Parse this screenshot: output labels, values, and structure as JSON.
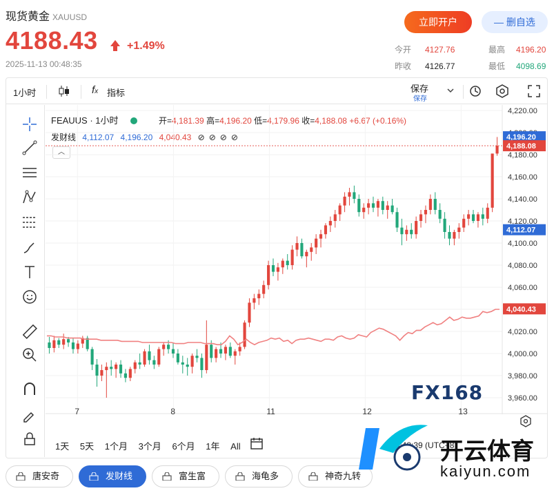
{
  "header": {
    "title": "现货黄金",
    "code": "XAUUSD",
    "price": "4188.43",
    "change_pct": "+1.49%",
    "timestamp": "2025-11-13 00:48:35",
    "btn_open": "立即开户",
    "btn_fav": "— 删自选",
    "stats": {
      "open_label": "今开",
      "open": "4127.76",
      "high_label": "最高",
      "high": "4196.20",
      "prev_label": "昨收",
      "prev": "4126.77",
      "low_label": "最低",
      "low": "4098.69"
    }
  },
  "toolbar": {
    "interval": "1小时",
    "indicator": "指标",
    "save": "保存",
    "save_sub": "保存"
  },
  "legend": {
    "ticker": "FEAUUS · 1小时",
    "open_label": "开=",
    "open": "4,181.39",
    "high_label": "高=",
    "high": "4,196.20",
    "low_label": "低=",
    "low": "4,179.96",
    "close_label": "收=",
    "close": "4,188.08",
    "change": "+6.67 (+0.16%)",
    "indicator_name": "发财线",
    "ind_v1": "4,112.07",
    "ind_v2": "4,196.20",
    "ind_v3": "4,040.43"
  },
  "ranges": [
    "1天",
    "5天",
    "1个月",
    "3个月",
    "6个月",
    "1年",
    "All"
  ],
  "time_readout": "00:48:39 (UTC+8)",
  "pills": [
    "唐安奇",
    "发财线",
    "富生富",
    "海龟多",
    "神奇九转"
  ],
  "watermark": "FX168",
  "logo_text": "开云体育",
  "logo_url": "kaiyun.com",
  "colors": {
    "up": "#e2463d",
    "down": "#22a77a",
    "accent": "#2f6bd6",
    "ma": "#f08080"
  },
  "chart_data": {
    "type": "candlestick",
    "y_ticks": [
      "4,220.00",
      "4,200.00",
      "4,180.00",
      "4,160.00",
      "4,140.00",
      "4,120.00",
      "4,100.00",
      "4,080.00",
      "4,060.00",
      "4,040.00",
      "4,020.00",
      "4,000.00",
      "3,980.00",
      "3,960.00"
    ],
    "y_range": [
      3950,
      4225
    ],
    "x_ticks": [
      "7",
      "8",
      "11",
      "12",
      "13"
    ],
    "price_tags": [
      {
        "text": "4,196.20",
        "value": 4196.2,
        "color": "#2f6bd6"
      },
      {
        "text": "4,188.08",
        "value": 4188.08,
        "color": "#e2463d"
      },
      {
        "text": "4,112.07",
        "value": 4112.07,
        "color": "#2f6bd6"
      },
      {
        "text": "4,040.43",
        "value": 4040.43,
        "color": "#e2463d"
      }
    ],
    "candles": [
      [
        4010,
        4015,
        4000,
        4005
      ],
      [
        4005,
        4016,
        4001,
        4012
      ],
      [
        4012,
        4014,
        4005,
        4008
      ],
      [
        4008,
        4018,
        4004,
        4013
      ],
      [
        4013,
        4015,
        4006,
        4010
      ],
      [
        4010,
        4014,
        4000,
        4004
      ],
      [
        4004,
        4012,
        4000,
        4009
      ],
      [
        4009,
        4016,
        4005,
        4014
      ],
      [
        4014,
        4016,
        4002,
        4004
      ],
      [
        4004,
        4006,
        3985,
        3990
      ],
      [
        3990,
        3995,
        3970,
        3980
      ],
      [
        3980,
        3990,
        3975,
        3985
      ],
      [
        3985,
        3992,
        3960,
        3988
      ],
      [
        3988,
        3994,
        3980,
        3986
      ],
      [
        3986,
        3992,
        3978,
        3990
      ],
      [
        3990,
        3994,
        3978,
        3982
      ],
      [
        3982,
        3986,
        3974,
        3978
      ],
      [
        3978,
        3988,
        3975,
        3986
      ],
      [
        3986,
        3994,
        3982,
        3992
      ],
      [
        3992,
        4000,
        3986,
        3990
      ],
      [
        3990,
        4004,
        3988,
        4002
      ],
      [
        4002,
        4008,
        3990,
        3994
      ],
      [
        3994,
        3998,
        3986,
        3990
      ],
      [
        3990,
        4006,
        3988,
        4004
      ],
      [
        4004,
        4010,
        3998,
        4008
      ],
      [
        4008,
        4012,
        4000,
        4004
      ],
      [
        4004,
        4010,
        3996,
        4000
      ],
      [
        4000,
        4004,
        3990,
        3992
      ],
      [
        3992,
        3998,
        3982,
        3990
      ],
      [
        3990,
        3996,
        3980,
        3988
      ],
      [
        3988,
        4000,
        3982,
        3998
      ],
      [
        3998,
        4004,
        3992,
        3996
      ],
      [
        3996,
        4000,
        3978,
        3985
      ],
      [
        3985,
        4030,
        3982,
        4008
      ],
      [
        4008,
        4012,
        3992,
        3996
      ],
      [
        3996,
        4006,
        3992,
        4004
      ],
      [
        4004,
        4010,
        3996,
        4000
      ],
      [
        4000,
        4008,
        3994,
        4006
      ],
      [
        4006,
        4010,
        3996,
        3998
      ],
      [
        3998,
        4004,
        3990,
        4002
      ],
      [
        4002,
        4010,
        3998,
        4006
      ],
      [
        4006,
        4030,
        4004,
        4028
      ],
      [
        4028,
        4050,
        4024,
        4046
      ],
      [
        4046,
        4054,
        4040,
        4050
      ],
      [
        4050,
        4058,
        4044,
        4054
      ],
      [
        4054,
        4066,
        4050,
        4062
      ],
      [
        4062,
        4084,
        4058,
        4080
      ],
      [
        4080,
        4086,
        4070,
        4074
      ],
      [
        4074,
        4082,
        4066,
        4078
      ],
      [
        4078,
        4086,
        4072,
        4084
      ],
      [
        4084,
        4090,
        4076,
        4080
      ],
      [
        4080,
        4098,
        4076,
        4094
      ],
      [
        4094,
        4106,
        4088,
        4100
      ],
      [
        4100,
        4104,
        4086,
        4088
      ],
      [
        4088,
        4094,
        4078,
        4092
      ],
      [
        4092,
        4100,
        4084,
        4096
      ],
      [
        4096,
        4108,
        4090,
        4104
      ],
      [
        4104,
        4112,
        4096,
        4108
      ],
      [
        4108,
        4118,
        4104,
        4116
      ],
      [
        4116,
        4124,
        4110,
        4120
      ],
      [
        4120,
        4130,
        4114,
        4126
      ],
      [
        4126,
        4136,
        4120,
        4134
      ],
      [
        4134,
        4146,
        4128,
        4142
      ],
      [
        4142,
        4150,
        4134,
        4146
      ],
      [
        4146,
        4152,
        4136,
        4140
      ],
      [
        4140,
        4144,
        4124,
        4128
      ],
      [
        4128,
        4136,
        4122,
        4132
      ],
      [
        4132,
        4140,
        4126,
        4136
      ],
      [
        4136,
        4142,
        4128,
        4132
      ],
      [
        4132,
        4140,
        4124,
        4138
      ],
      [
        4138,
        4142,
        4126,
        4130
      ],
      [
        4130,
        4138,
        4122,
        4134
      ],
      [
        4134,
        4140,
        4126,
        4128
      ],
      [
        4128,
        4132,
        4110,
        4114
      ],
      [
        4114,
        4122,
        4098,
        4108
      ],
      [
        4108,
        4116,
        4102,
        4112
      ],
      [
        4112,
        4118,
        4104,
        4108
      ],
      [
        4108,
        4124,
        4104,
        4120
      ],
      [
        4120,
        4130,
        4114,
        4126
      ],
      [
        4126,
        4134,
        4118,
        4130
      ],
      [
        4130,
        4144,
        4126,
        4140
      ],
      [
        4140,
        4146,
        4126,
        4130
      ],
      [
        4130,
        4136,
        4118,
        4122
      ],
      [
        4122,
        4128,
        4104,
        4110
      ],
      [
        4110,
        4116,
        4098,
        4104
      ],
      [
        4104,
        4112,
        4098,
        4110
      ],
      [
        4110,
        4118,
        4104,
        4114
      ],
      [
        4114,
        4126,
        4110,
        4122
      ],
      [
        4122,
        4130,
        4116,
        4126
      ],
      [
        4126,
        4130,
        4118,
        4120
      ],
      [
        4120,
        4128,
        4114,
        4126
      ],
      [
        4126,
        4132,
        4116,
        4122
      ],
      [
        4122,
        4136,
        4118,
        4132
      ],
      [
        4132,
        4164,
        4128,
        4181
      ],
      [
        4181,
        4196,
        4179,
        4188
      ]
    ],
    "ma_line": [
      4016,
      4016,
      4015,
      4015,
      4015,
      4014,
      4014,
      4014,
      4014,
      4013,
      4013,
      4013,
      4013,
      4012,
      4012,
      4012,
      4012,
      4012,
      4011,
      4011,
      4011,
      4011,
      4011,
      4010,
      4010,
      4010,
      4010,
      4010,
      4010,
      4010,
      4010,
      4009,
      4009,
      4009,
      4010,
      4010,
      4010,
      4010,
      4009,
      4009,
      4009,
      4008,
      4008,
      4011,
      4016,
      4013,
      4008,
      4010,
      4013,
      4010,
      4008,
      4010,
      4011,
      4012,
      4014,
      4013,
      4014,
      4011,
      4012,
      4009,
      4012,
      4013,
      4013,
      4014,
      4013,
      4012,
      4011,
      4013,
      4013,
      4012,
      4015,
      4016,
      4014,
      4013,
      4014,
      4017,
      4016,
      4015,
      4019,
      4021,
      4023,
      4022,
      4020,
      4018,
      4016,
      4012,
      4016,
      4019,
      4018,
      4021,
      4021,
      4024,
      4026,
      4028,
      4026,
      4027,
      4030,
      4033,
      4030,
      4031,
      4033,
      4032,
      4032,
      4033,
      4034,
      4038,
      4037,
      4038,
      4040,
      4040
    ]
  }
}
